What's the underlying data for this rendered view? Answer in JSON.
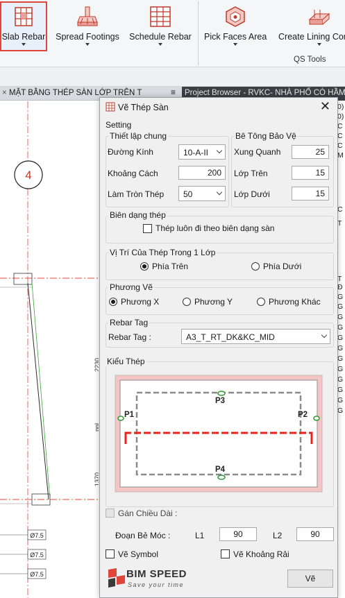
{
  "ribbon": {
    "buttons": [
      {
        "label": "Slab Rebar",
        "icon": "slab-rebar-icon"
      },
      {
        "label": "Spread Footings",
        "icon": "spread-footing-icon"
      },
      {
        "label": "Schedule Rebar",
        "icon": "schedule-icon"
      },
      {
        "label": "Pick Faces Area",
        "icon": "pick-faces-icon"
      },
      {
        "label": "Create Lining Con",
        "icon": "lining-icon"
      }
    ],
    "panel_label": "QS Tools"
  },
  "view_tab": {
    "title": "MẶT BẰNG THÉP SÀN LỚP TRÊN T",
    "menu": "≡"
  },
  "browser": {
    "title": "Project Browser - RVKC- NHÀ PHỐ CÓ HẦM"
  },
  "canvas": {
    "grid_bubble": "4",
    "dims": [
      "2230",
      "ppl",
      "1370"
    ],
    "rebar_labels": [
      "Ø7.5",
      "Ø7.5",
      "Ø7.5"
    ]
  },
  "dialog": {
    "title": "Vẽ Thép Sàn",
    "close_glyph": "✕",
    "setting_label": "Setting",
    "thiet_lap": {
      "label": "Thiết lập chung",
      "duong_kinh": {
        "label": "Đường Kính",
        "value": "10-A-II"
      },
      "khoang_cach": {
        "label": "Khoảng Cách",
        "value": "200"
      },
      "lam_tron": {
        "label": "Làm Tròn Thép",
        "value": "50"
      }
    },
    "be_tong": {
      "label": "Bê Tông Bảo Vệ",
      "xung_quanh": {
        "label": "Xung Quanh",
        "value": "25"
      },
      "lop_tren": {
        "label": "Lớp Trên",
        "value": "15"
      },
      "lop_duoi": {
        "label": "Lớp Dưới",
        "value": "15"
      }
    },
    "bien_dang": {
      "label": "Biên dạng thép",
      "check_label": "Thép luôn đi theo biên dạng sàn",
      "checked": false
    },
    "vi_tri": {
      "label": "Vị Trí Của Thép Trong 1 Lớp",
      "options": [
        "Phía Trên",
        "Phía Dưới"
      ],
      "selected": 0
    },
    "phuong_ve": {
      "label": "Phương Vẽ",
      "options": [
        "Phương X",
        "Phương Y",
        "Phương Khác"
      ],
      "selected": 0
    },
    "rebar_tag": {
      "group_label": "Rebar Tag",
      "label": "Rebar Tag :",
      "value": "A3_T_RT_DK&KC_MID"
    },
    "kieu_thep": {
      "label": "Kiểu Thép",
      "points": [
        "P1",
        "P2",
        "P3",
        "P4"
      ]
    },
    "gan_chieu_dai": {
      "label": "Gán Chiều Dài :",
      "checked": false
    },
    "doan_be_moc": {
      "label": "Đoạn Bẻ Móc :",
      "l1_label": "L1",
      "l1_value": "90",
      "l2_label": "L2",
      "l2_value": "90"
    },
    "ve_symbol": {
      "label": "Vẽ Symbol",
      "checked": false
    },
    "ve_khoang_rai": {
      "label": "Vẽ Khoảng Rải",
      "checked": false
    },
    "logo": {
      "name": "BIM SPEED",
      "tagline": "Save your time"
    },
    "draw_button": "Vẽ"
  },
  "right_strip": [
    "0)",
    "0)",
    "C",
    "C",
    "C",
    "M",
    "C",
    "T",
    "T",
    "Đ",
    "G",
    "G",
    "G",
    "G",
    "G",
    "G",
    "G",
    "G",
    "G",
    "G",
    "G",
    "G"
  ],
  "colors": {
    "accent_red": "#e0453b",
    "rebar_red": "#e8231c",
    "green_point": "#2e9a2e"
  }
}
